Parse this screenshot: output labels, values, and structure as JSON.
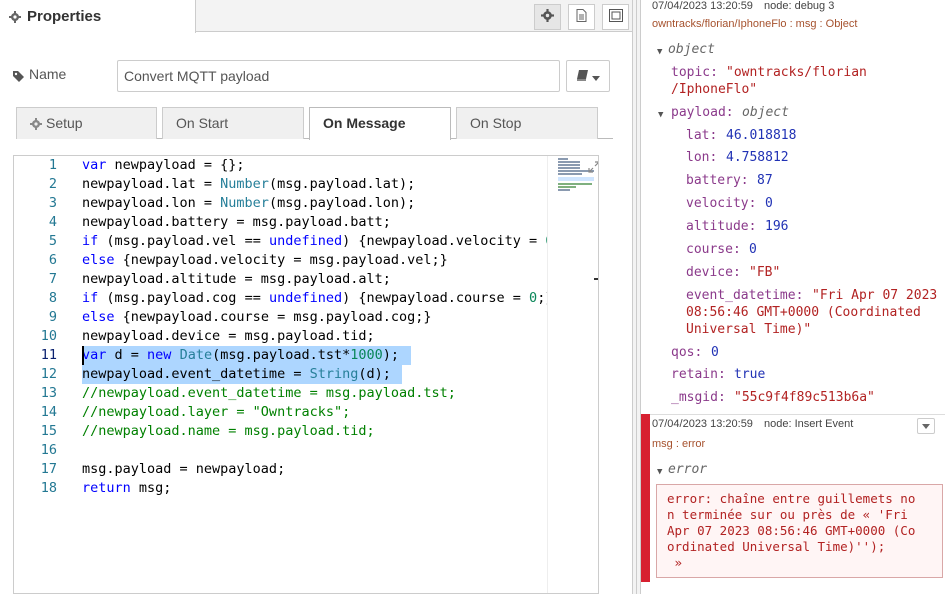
{
  "properties": {
    "title": "Properties",
    "name_label": "Name",
    "name_value": "Convert MQTT payload",
    "tabs": [
      "Setup",
      "On Start",
      "On Message",
      "On Stop"
    ]
  },
  "editor": {
    "line_numbers": [
      "1",
      "2",
      "3",
      "4",
      "5",
      "6",
      "7",
      "8",
      "9",
      "10",
      "11",
      "12",
      "13",
      "14",
      "15",
      "16",
      "17",
      "18"
    ]
  },
  "debug": {
    "msg1": {
      "time": "07/04/2023 13:20:59",
      "node": "node: debug 3",
      "topic_line": "owntracks/florian/IphoneFlo : msg : Object",
      "root_type": "object",
      "topic_key": "topic:",
      "topic_val_l1": "\"owntracks/florian",
      "topic_val_l2": "/IphoneFlo\"",
      "payload_key": "payload:",
      "payload_type": "object",
      "lat_key": "lat:",
      "lat_val": "46.018818",
      "lon_key": "lon:",
      "lon_val": "4.758812",
      "battery_key": "battery:",
      "battery_val": "87",
      "velocity_key": "velocity:",
      "velocity_val": "0",
      "altitude_key": "altitude:",
      "altitude_val": "196",
      "course_key": "course:",
      "course_val": "0",
      "device_key": "device:",
      "device_val": "\"FB\"",
      "event_key": "event_datetime:",
      "event_val_l1": "\"Fri Apr 07 2023",
      "event_val_l2": "08:56:46 GMT+0000 (Coordinated",
      "event_val_l3": "Universal Time)\"",
      "qos_key": "qos:",
      "qos_val": "0",
      "retain_key": "retain:",
      "retain_val": "true",
      "msgid_key": "_msgid:",
      "msgid_val": "\"55c9f4f89c513b6a\""
    },
    "msg2": {
      "time": "07/04/2023 13:20:59",
      "node": "node: Insert Event",
      "topic_line": "msg : error",
      "root_type": "error",
      "error_text": "error: chaîne entre guillemets no\nn terminée sur ou près de « 'Fri\nApr 07 2023 08:56:46 GMT+0000 (Co\nordinated Universal Time)'');\n »"
    }
  }
}
